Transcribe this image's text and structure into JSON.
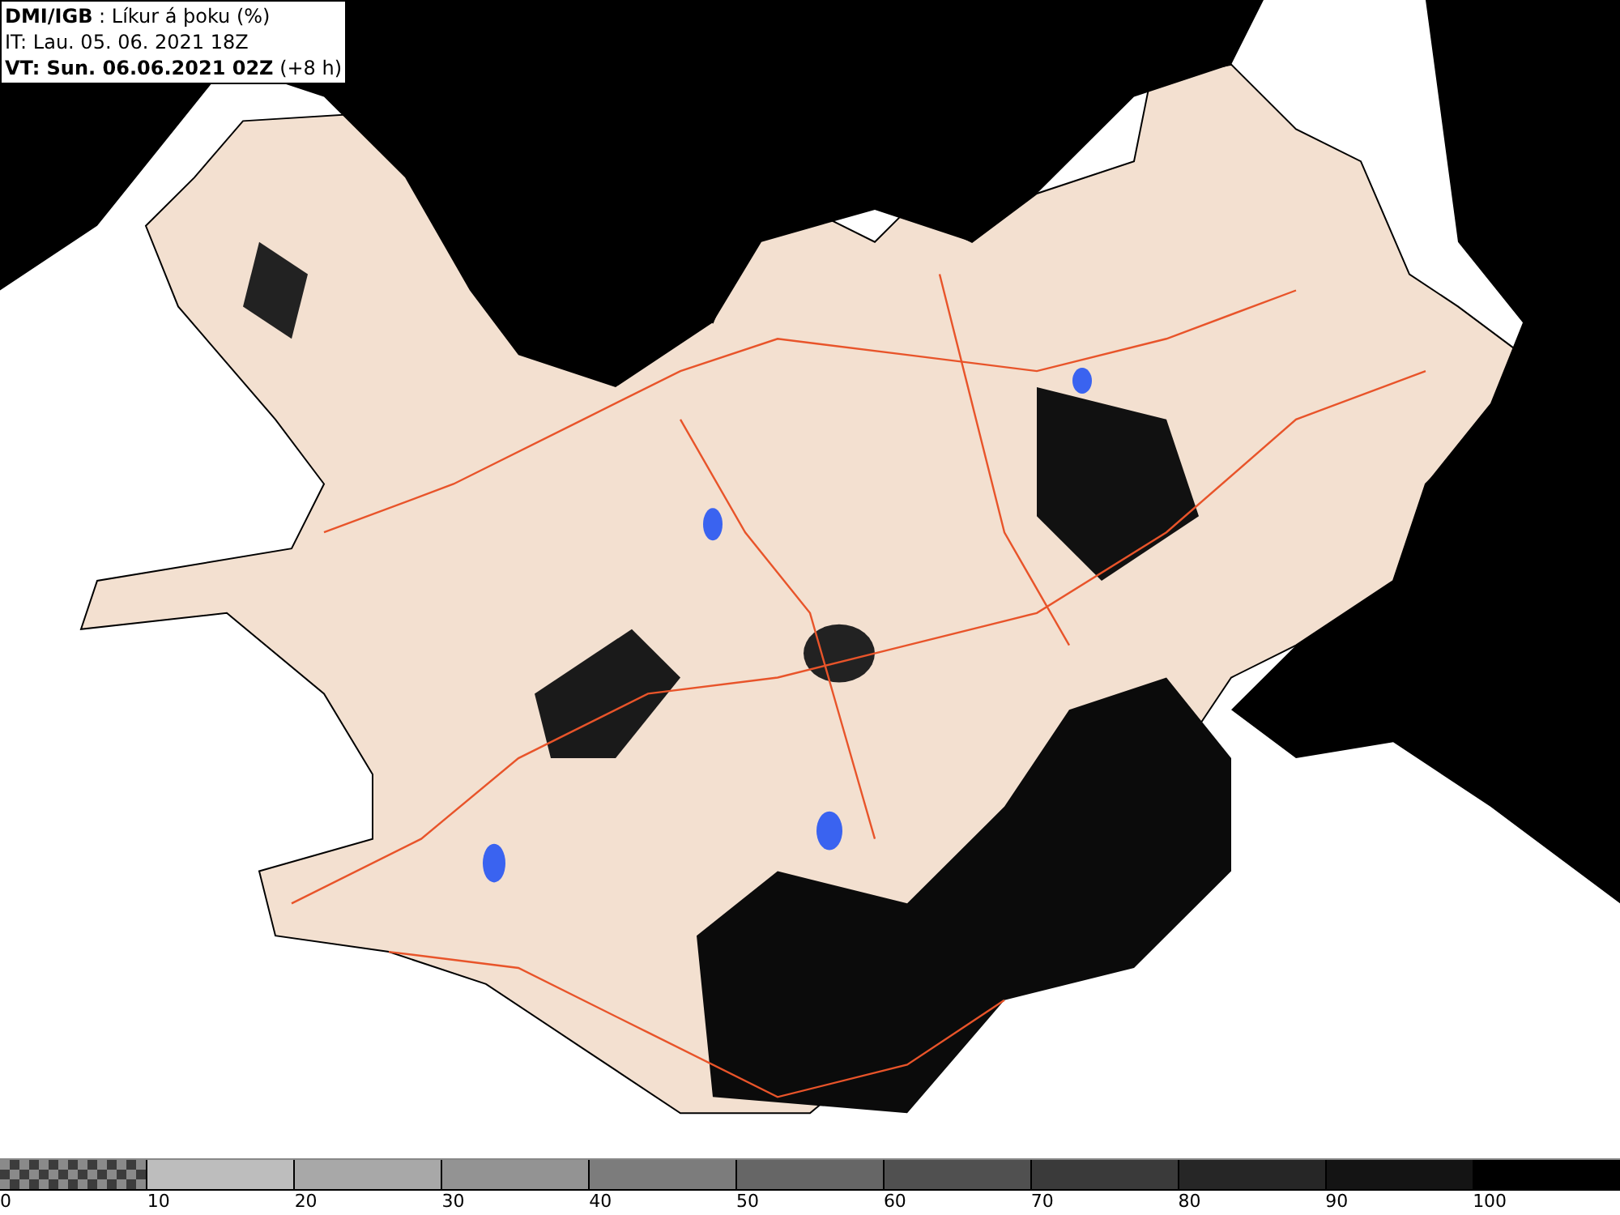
{
  "header": {
    "lines": [
      "**DMI/IGB** : Líkur á þoku (%)",
      "IT: Lau. 05. 06. 2021 18Z",
      "**VT: Sun. 06.06.2021 02Z** (+8 h)"
    ]
  },
  "legend": {
    "segments": [
      {
        "kind": "checker",
        "color": "#8a8a8a"
      },
      {
        "kind": "solid",
        "color": "#bdbdbd"
      },
      {
        "kind": "solid",
        "color": "#a8a8a8"
      },
      {
        "kind": "solid",
        "color": "#939393"
      },
      {
        "kind": "solid",
        "color": "#7c7c7c"
      },
      {
        "kind": "solid",
        "color": "#666666"
      },
      {
        "kind": "solid",
        "color": "#505050"
      },
      {
        "kind": "solid",
        "color": "#3a3a3a"
      },
      {
        "kind": "solid",
        "color": "#262626"
      },
      {
        "kind": "solid",
        "color": "#141414"
      },
      {
        "kind": "solid",
        "color": "#000000"
      }
    ],
    "labels": [
      "0",
      "10",
      "20",
      "30",
      "40",
      "50",
      "60",
      "70",
      "80",
      "90",
      "100"
    ]
  }
}
